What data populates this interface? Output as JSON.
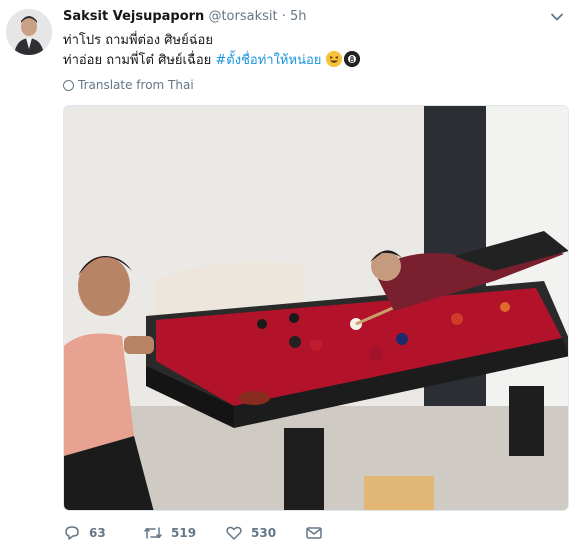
{
  "author": {
    "name": "Saksit Vejsupaporn",
    "handle": "@torsaksit",
    "separator": "·",
    "time": "5h"
  },
  "tweet": {
    "line1": "ท่าโปร ถามพี่ต่อง ศิษย์ฉ่อย",
    "line2_prefix": "ท่าอ่อย ถามพี่โต๋ ศิษย์เฉื่อย ",
    "hashtag": "#ตั้งชื่อท่าให้หน่อย"
  },
  "translate": {
    "label": "Translate from Thai"
  },
  "actions": {
    "replies": "63",
    "retweets": "519",
    "likes": "530"
  },
  "colors": {
    "link": "#1b95e0",
    "muted": "#657786",
    "felt": "#b3122b"
  },
  "icons": [
    "chevron-down-icon",
    "globe-icon",
    "reply-icon",
    "retweet-icon",
    "like-icon",
    "message-icon",
    "grinning-squint-emoji",
    "pool-8-ball-emoji"
  ]
}
